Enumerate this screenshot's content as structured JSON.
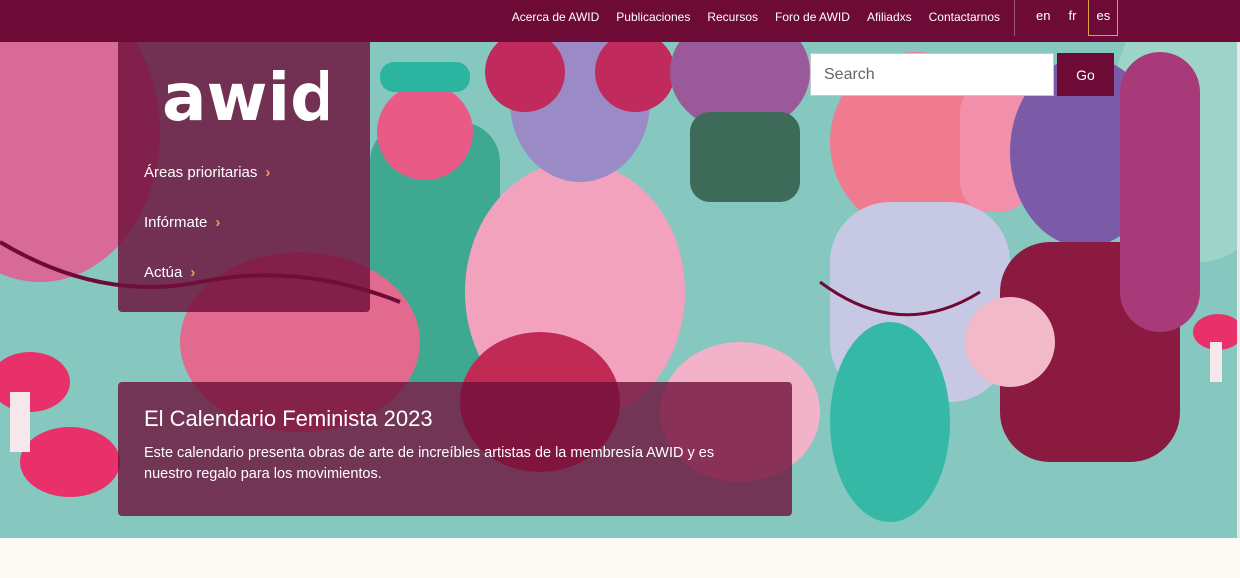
{
  "topnav": {
    "items": [
      {
        "label": "Acerca de AWID"
      },
      {
        "label": "Publicaciones"
      },
      {
        "label": "Recursos"
      },
      {
        "label": "Foro de AWID"
      },
      {
        "label": "Afiliadxs"
      },
      {
        "label": "Contactarnos"
      }
    ],
    "languages": [
      {
        "label": "en",
        "active": false
      },
      {
        "label": "fr",
        "active": false
      },
      {
        "label": "es",
        "active": true
      }
    ]
  },
  "brand": {
    "logo_text": "awid"
  },
  "sidebar": {
    "items": [
      {
        "label": "Áreas prioritarias",
        "icon": "chevron-right-icon"
      },
      {
        "label": "Infórmate",
        "icon": "chevron-right-icon"
      },
      {
        "label": "Actúa",
        "icon": "chevron-right-icon"
      }
    ]
  },
  "search": {
    "placeholder": "Search",
    "value": "",
    "button_label": "Go"
  },
  "feature": {
    "title": "El Calendario Feminista 2023",
    "description": "Este calendario presenta obras de arte de increíbles artistas de la membresía AWID y es nuestro regalo para los movimientos."
  },
  "colors": {
    "primary": "#6e0a36",
    "accent": "#e9a34a",
    "page_bg": "#fcfaf5"
  }
}
